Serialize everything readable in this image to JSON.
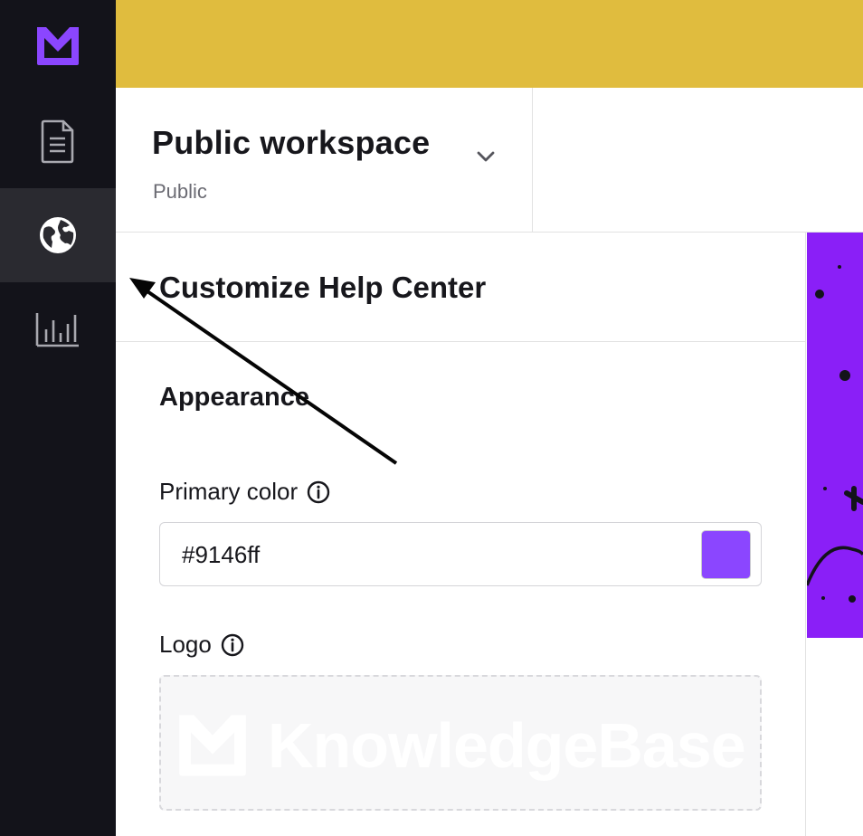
{
  "workspace": {
    "title": "Public workspace",
    "subtitle": "Public"
  },
  "panel": {
    "title": "Customize Help Center",
    "section": "Appearance",
    "primary_color": {
      "label": "Primary color",
      "value": "#9146ff"
    },
    "logo": {
      "label": "Logo",
      "placeholder_text": "KnowledgeBase"
    }
  },
  "sidebar": {
    "items": [
      {
        "icon": "document-icon"
      },
      {
        "icon": "globe-icon",
        "active": true
      },
      {
        "icon": "bar-chart-icon"
      }
    ]
  },
  "colors": {
    "sidebar_bg": "#13131a",
    "banner": "#e0bc3e",
    "brand": "#8b46ff",
    "preview": "#8a1ff7"
  }
}
